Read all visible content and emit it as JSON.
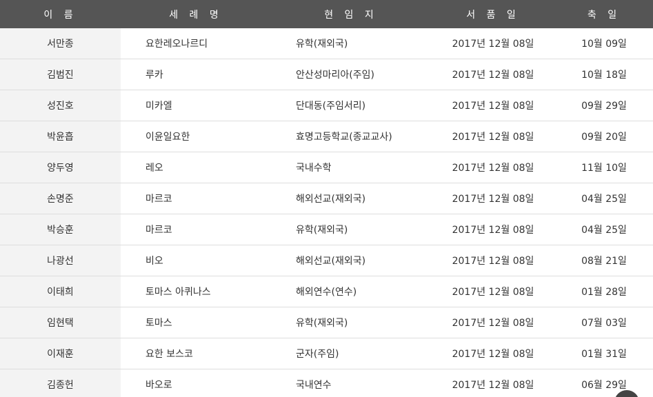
{
  "headers": {
    "name": "이 름",
    "baptism": "세 례 명",
    "location": "현 임 지",
    "ordination": "서 품 일",
    "feast": "축 일"
  },
  "rows": [
    {
      "name": "서만종",
      "baptism": "요한레오나르디",
      "location": "유학(재외국)",
      "ordination": "2017년 12월 08일",
      "feast": "10월 09일"
    },
    {
      "name": "김범진",
      "baptism": "루카",
      "location": "안산성마리아(주임)",
      "ordination": "2017년 12월 08일",
      "feast": "10월 18일"
    },
    {
      "name": "성진호",
      "baptism": "미카엘",
      "location": "단대동(주임서리)",
      "ordination": "2017년 12월 08일",
      "feast": "09월 29일"
    },
    {
      "name": "박윤흡",
      "baptism": "이윤일요한",
      "location": "효명고등학교(종교교사)",
      "ordination": "2017년 12월 08일",
      "feast": "09월 20일"
    },
    {
      "name": "양두영",
      "baptism": "레오",
      "location": "국내수학",
      "ordination": "2017년 12월 08일",
      "feast": "11월 10일"
    },
    {
      "name": "손명준",
      "baptism": "마르코",
      "location": "해외선교(재외국)",
      "ordination": "2017년 12월 08일",
      "feast": "04월 25일"
    },
    {
      "name": "박승훈",
      "baptism": "마르코",
      "location": "유학(재외국)",
      "ordination": "2017년 12월 08일",
      "feast": "04월 25일"
    },
    {
      "name": "나광선",
      "baptism": "비오",
      "location": "해외선교(재외국)",
      "ordination": "2017년 12월 08일",
      "feast": "08월 21일"
    },
    {
      "name": "이태희",
      "baptism": "토마스 아퀴나스",
      "location": "해외연수(연수)",
      "ordination": "2017년 12월 08일",
      "feast": "01월 28일"
    },
    {
      "name": "임현택",
      "baptism": "토마스",
      "location": "유학(재외국)",
      "ordination": "2017년 12월 08일",
      "feast": "07월 03일"
    },
    {
      "name": "이재훈",
      "baptism": "요한 보스코",
      "location": "군자(주임)",
      "ordination": "2017년 12월 08일",
      "feast": "01월 31일"
    },
    {
      "name": "김종헌",
      "baptism": "바오로",
      "location": "국내연수",
      "ordination": "2017년 12월 08일",
      "feast": "06월 29일"
    }
  ]
}
